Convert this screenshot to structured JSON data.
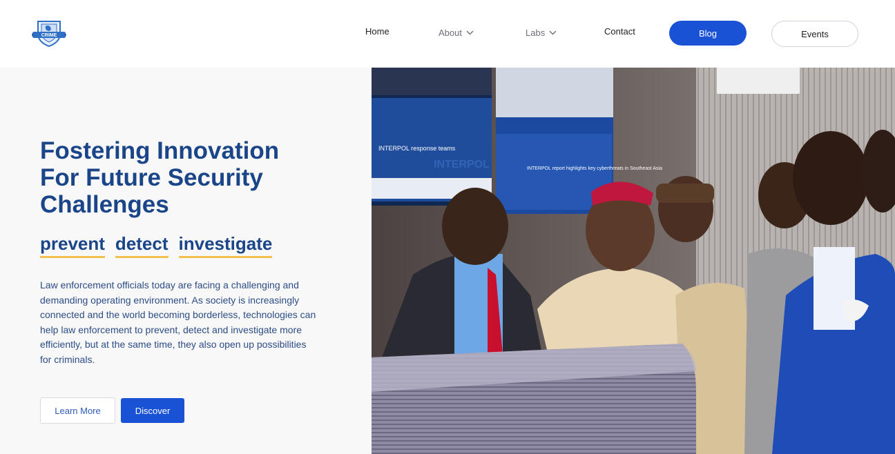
{
  "header": {
    "logo_text": "CRIME",
    "nav": {
      "home": "Home",
      "about": "About",
      "labs": "Labs",
      "contact": "Contact"
    },
    "blog_label": "Blog",
    "events_label": "Events"
  },
  "hero": {
    "title": "Fostering Innovation For Future Security Challenges",
    "keywords": [
      "prevent",
      "detect",
      "investigate"
    ],
    "text": "Law enforcement officials today are facing a challenging and demanding operating environment. As society is increasingly connected and the world becoming borderless, technologies can help law enforcement to prevent, detect and investigate more efficiently, but at the same time, they also open up possibilities for criminals.",
    "learn_more_label": "Learn More",
    "discover_label": "Discover"
  },
  "photo": {
    "screen_left_text": "INTERPOL response teams",
    "screen_right_text": "INTERPOL report highlights key cyberthreats in Southeast Asia",
    "screen_logo_text": "INTERPOL"
  },
  "colors": {
    "primary": "#1a52d6",
    "heading": "#1b4589",
    "accent_underline": "#f2c14e",
    "hero_bg": "#f8f8f8"
  }
}
